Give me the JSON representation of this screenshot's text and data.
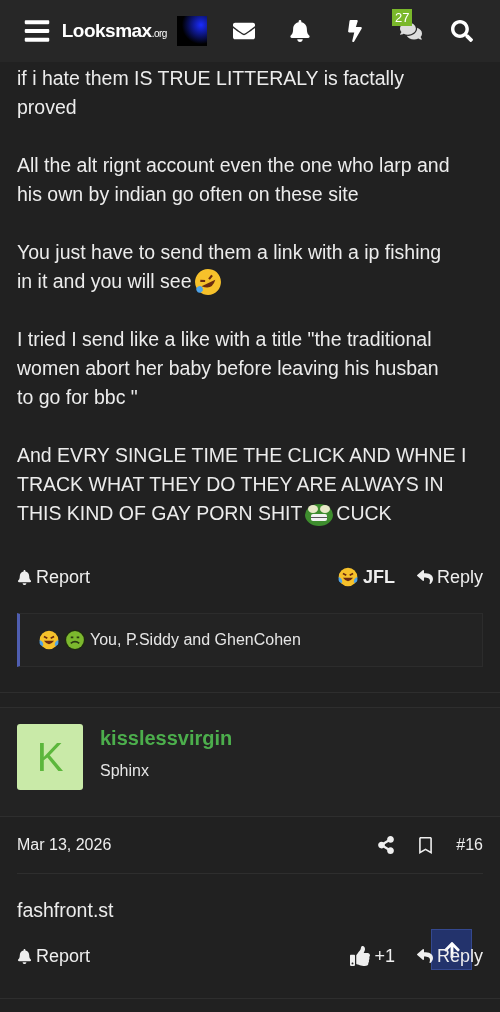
{
  "header": {
    "logo": "Looksmax",
    "logo_suffix": ".org",
    "badge": "27"
  },
  "posts": [
    {
      "paragraphs": [
        [
          [
            {
              "kind": "text",
              "text": "if i hate them IS TRUE LITTERALY is factally"
            }
          ],
          [
            {
              "kind": "text",
              "text": "proved"
            }
          ]
        ],
        [
          [
            {
              "kind": "text",
              "text": "All the alt rignt account even the one who larp and"
            }
          ],
          [
            {
              "kind": "text",
              "text": "his own by indian go often on these site"
            }
          ]
        ],
        [
          [
            {
              "kind": "text",
              "text": "You just have to send them a link with a ip fishing"
            }
          ],
          [
            {
              "kind": "text",
              "text": "in it and you will see"
            },
            {
              "kind": "rofl"
            }
          ]
        ],
        [
          [
            {
              "kind": "text",
              "text": "I tried I send like a like with a title \"the traditional"
            }
          ],
          [
            {
              "kind": "text",
              "text": "women abort her baby before leaving his husban"
            }
          ],
          [
            {
              "kind": "text",
              "text": "to go for bbc \""
            }
          ]
        ],
        [
          [
            {
              "kind": "text",
              "text": "And EVRY SINGLE TIME THE CLICK AND WHNE I"
            }
          ],
          [
            {
              "kind": "text",
              "text": "TRACK WHAT THEY DO THEY ARE ALWAYS IN"
            }
          ],
          [
            {
              "kind": "text",
              "text": "THIS KIND OF GAY PORN SHIT"
            },
            {
              "kind": "frog"
            },
            {
              "kind": "text",
              "text": "CUCK"
            }
          ]
        ]
      ],
      "report": "Report",
      "reaction": {
        "kind": "crying-laugh",
        "label": "JFL"
      },
      "reply": "Reply",
      "reactions": {
        "emojis": [
          {
            "kind": "crying-laugh"
          },
          {
            "kind": "nauseated"
          }
        ],
        "text": "You, P.Siddy and GhenCohen"
      }
    },
    {
      "author": {
        "initial": "K",
        "name": "kisslessvirgin",
        "title": "Sphinx"
      },
      "date": "Mar 13, 2026",
      "number": "#16",
      "paragraphs": [
        [
          [
            {
              "kind": "text",
              "text": "fashfront.st"
            }
          ]
        ]
      ],
      "report": "Report",
      "reaction": {
        "kind": "thumbs",
        "label": "+1"
      },
      "reply": "Reply"
    }
  ]
}
